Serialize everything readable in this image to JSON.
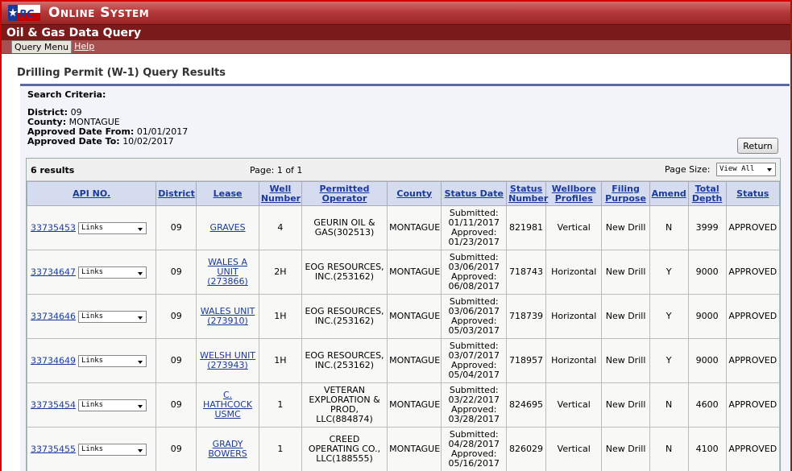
{
  "brand": {
    "title": "Online System"
  },
  "app": {
    "title": "Oil & Gas Data Query"
  },
  "menu": {
    "query_menu": "Query Menu",
    "help": "Help"
  },
  "page": {
    "title": "Drilling Permit (W-1) Query Results"
  },
  "criteria": {
    "heading": "Search Criteria:",
    "district_label": "District:",
    "district": "09",
    "county_label": "County:",
    "county": "MONTAGUE",
    "from_label": "Approved Date From:",
    "from": "01/01/2017",
    "to_label": "Approved Date To:",
    "to": "10/02/2017"
  },
  "return_label": "Return",
  "results": {
    "count": "6 results",
    "pager": "Page: 1 of 1",
    "page_size_label": "Page Size:",
    "page_size_value": "View All"
  },
  "columns": [
    "API NO.",
    "District",
    "Lease",
    "Well Number",
    "Permitted Operator",
    "County",
    "Status Date",
    "Status Number",
    "Wellbore Profiles",
    "Filing Purpose",
    "Amend",
    "Total Depth",
    "Status"
  ],
  "rows": [
    {
      "api": "33735453",
      "links": "Links",
      "district": "09",
      "lease": "GRAVES",
      "well": "4",
      "operator": "GEURIN OIL & GAS(302513)",
      "county": "MONTAGUE",
      "submitted": "01/11/2017",
      "approved": "01/23/2017",
      "status_number": "821981",
      "profile": "Vertical",
      "purpose": "New Drill",
      "amend": "N",
      "depth": "3999",
      "status": "APPROVED"
    },
    {
      "api": "33734647",
      "links": "Links",
      "district": "09",
      "lease": "WALES A UNIT (273866)",
      "well": "2H",
      "operator": "EOG RESOURCES, INC.(253162)",
      "county": "MONTAGUE",
      "submitted": "03/06/2017",
      "approved": "06/08/2017",
      "status_number": "718743",
      "profile": "Horizontal",
      "purpose": "New Drill",
      "amend": "Y",
      "depth": "9000",
      "status": "APPROVED"
    },
    {
      "api": "33734646",
      "links": "Links",
      "district": "09",
      "lease": "WALES UNIT (273910)",
      "well": "1H",
      "operator": "EOG RESOURCES, INC.(253162)",
      "county": "MONTAGUE",
      "submitted": "03/06/2017",
      "approved": "05/03/2017",
      "status_number": "718739",
      "profile": "Horizontal",
      "purpose": "New Drill",
      "amend": "Y",
      "depth": "9000",
      "status": "APPROVED"
    },
    {
      "api": "33734649",
      "links": "Links",
      "district": "09",
      "lease": "WELSH UNIT (273943)",
      "well": "1H",
      "operator": "EOG RESOURCES, INC.(253162)",
      "county": "MONTAGUE",
      "submitted": "03/07/2017",
      "approved": "05/04/2017",
      "status_number": "718957",
      "profile": "Horizontal",
      "purpose": "New Drill",
      "amend": "Y",
      "depth": "9000",
      "status": "APPROVED"
    },
    {
      "api": "33735454",
      "links": "Links",
      "district": "09",
      "lease": "C. HATHCOCK USMC",
      "well": "1",
      "operator": "VETERAN EXPLORATION & PROD, LLC(884874)",
      "county": "MONTAGUE",
      "submitted": "03/22/2017",
      "approved": "03/28/2017",
      "status_number": "824695",
      "profile": "Vertical",
      "purpose": "New Drill",
      "amend": "N",
      "depth": "4600",
      "status": "APPROVED"
    },
    {
      "api": "33735455",
      "links": "Links",
      "district": "09",
      "lease": "GRADY BOWERS",
      "well": "1",
      "operator": "CREED OPERATING CO., LLC(188555)",
      "county": "MONTAGUE",
      "submitted": "04/28/2017",
      "approved": "05/16/2017",
      "status_number": "826029",
      "profile": "Vertical",
      "purpose": "New Drill",
      "amend": "N",
      "depth": "4100",
      "status": "APPROVED"
    }
  ],
  "status_date_labels": {
    "submitted": "Submitted:",
    "approved": "Approved:"
  }
}
